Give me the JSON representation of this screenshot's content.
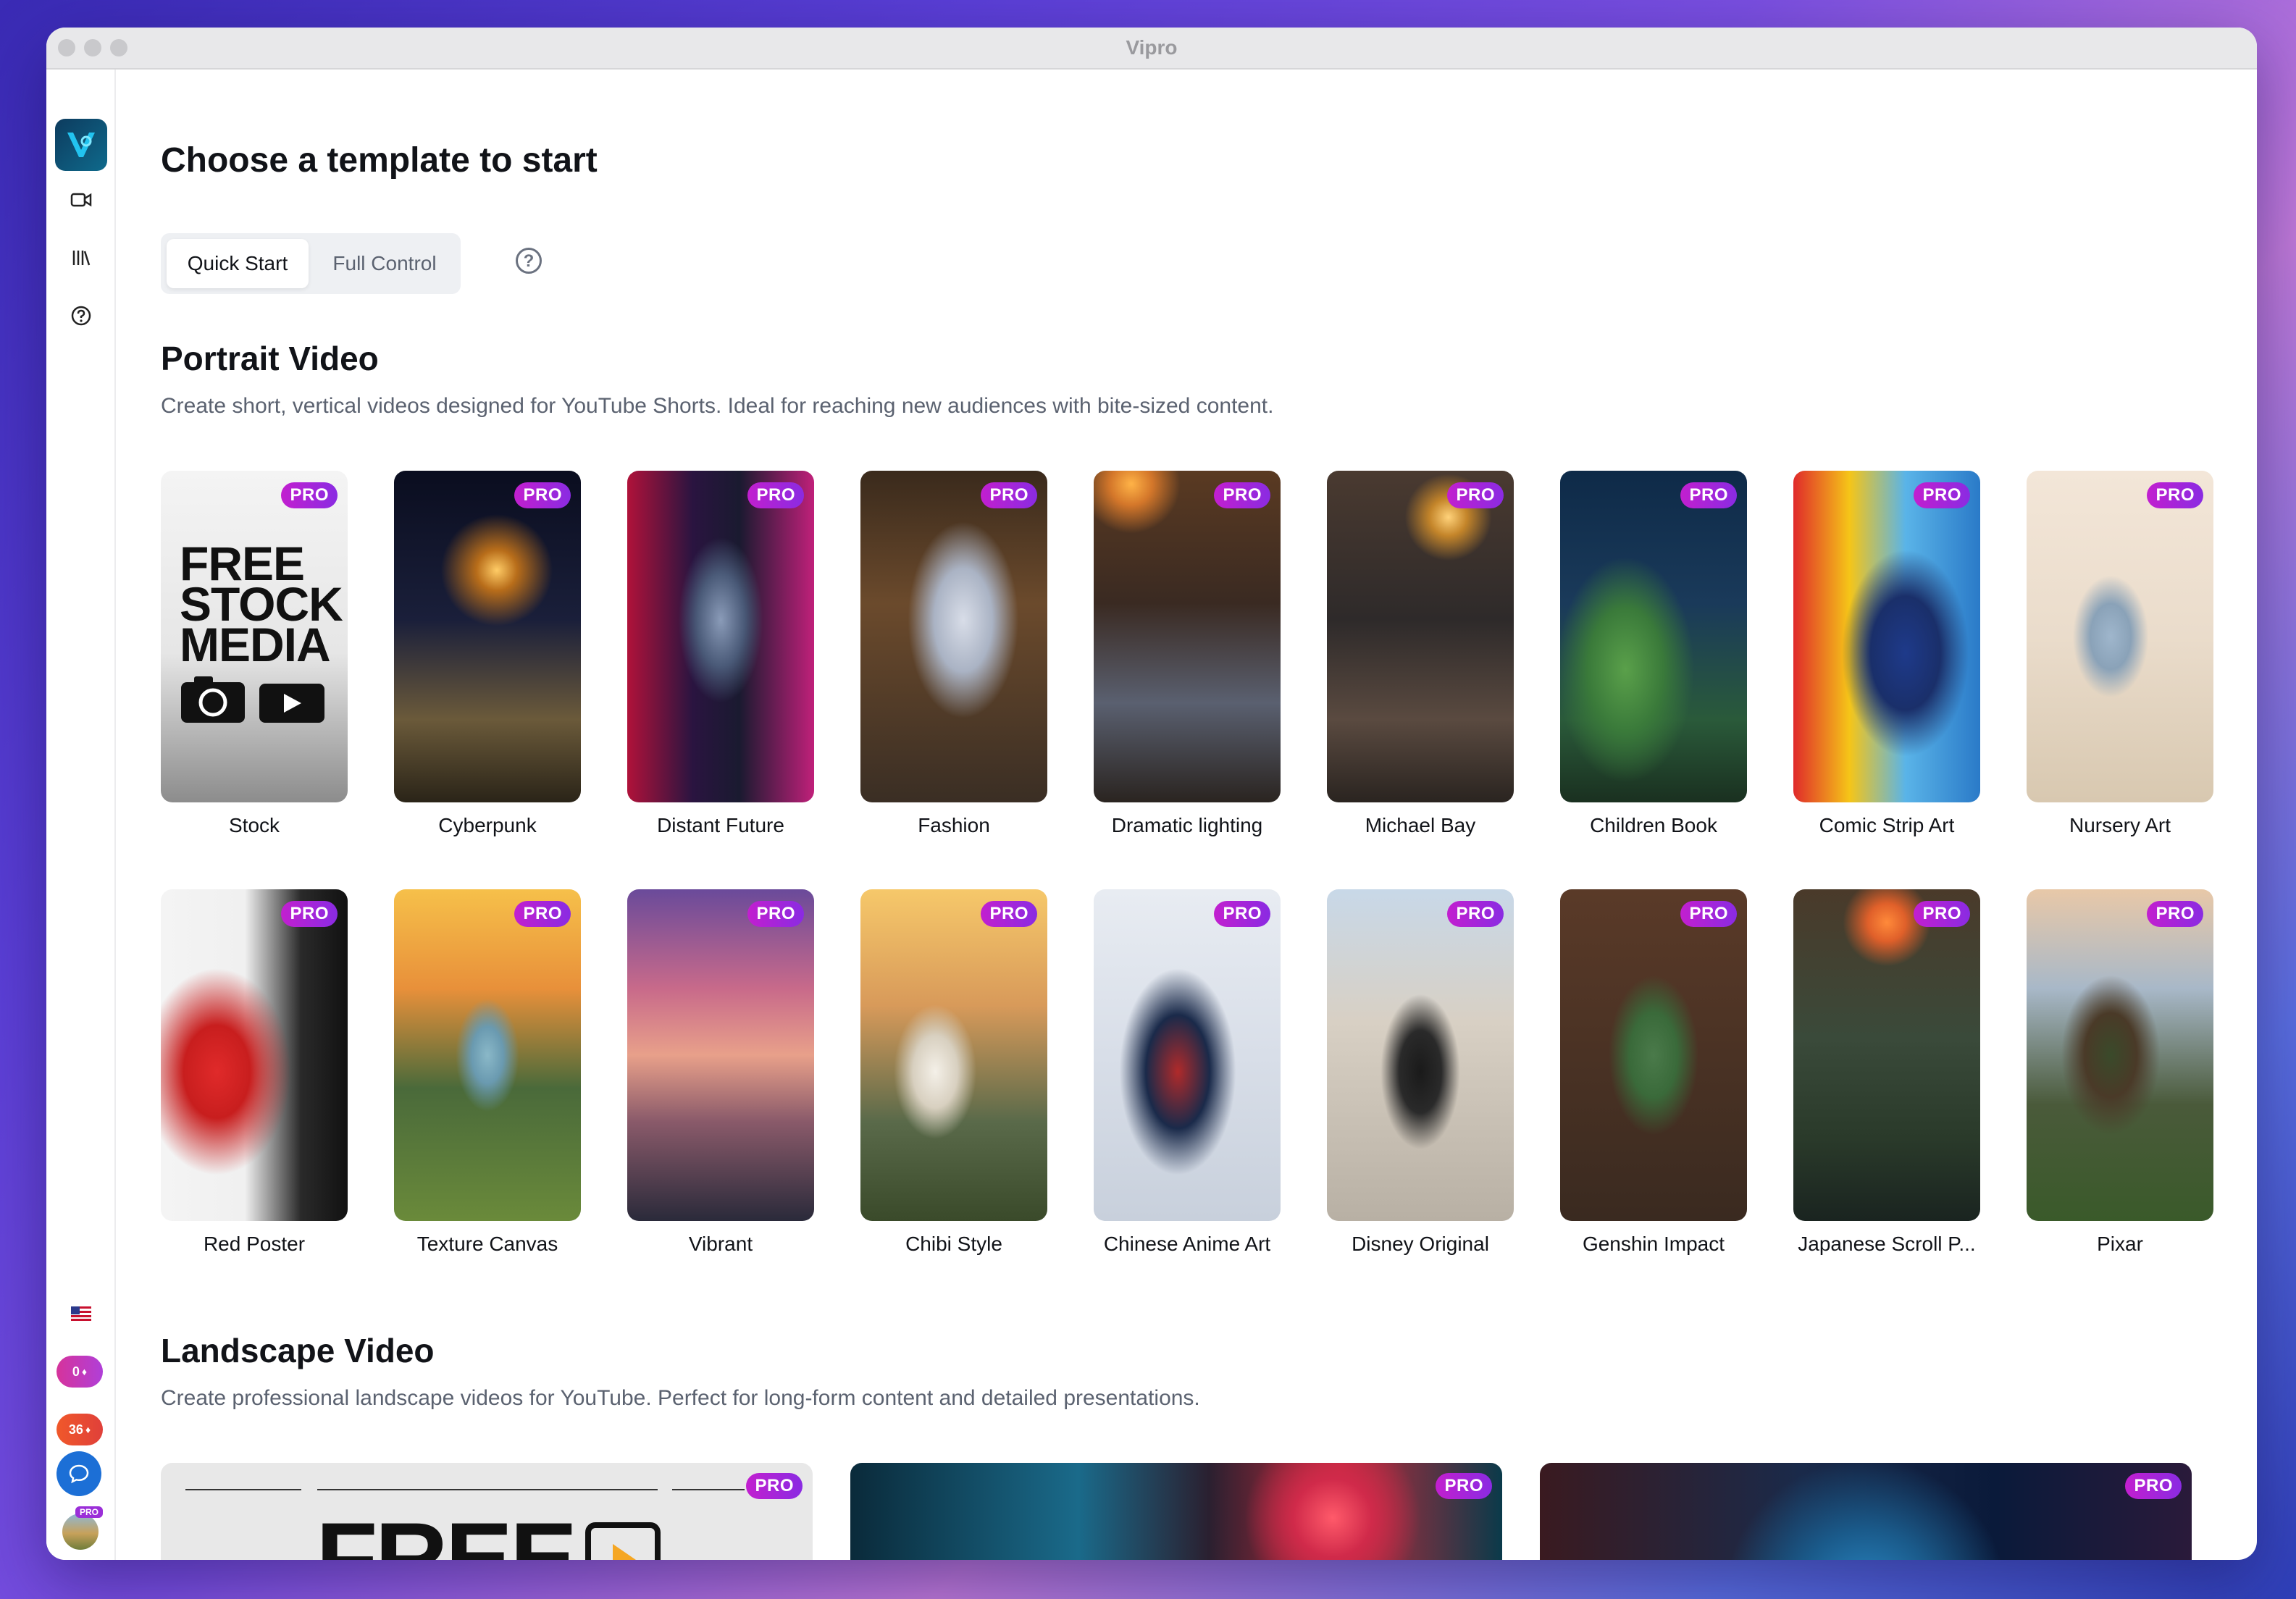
{
  "window": {
    "title": "Vipro"
  },
  "page": {
    "title": "Choose a template to start",
    "modes": [
      "Quick Start",
      "Full Control"
    ],
    "help_glyph": "?"
  },
  "sidebar": {
    "icons": [
      "video-camera-icon",
      "library-icon",
      "help-circle-icon"
    ],
    "credit_a": "0",
    "credit_b": "36"
  },
  "badge": "PRO",
  "portrait": {
    "title": "Portrait Video",
    "description": "Create short, vertical videos designed for YouTube Shorts. Ideal for reaching new audiences with bite-sized content.",
    "stock_text": "FREE STOCK MEDIA",
    "templates": [
      "Stock",
      "Cyberpunk",
      "Distant Future",
      "Fashion",
      "Dramatic lighting",
      "Michael Bay",
      "Children Book",
      "Comic Strip Art",
      "Nursery Art",
      "Red Poster",
      "Texture Canvas",
      "Vibrant",
      "Chibi Style",
      "Chinese Anime Art",
      "Disney Original",
      "Genshin Impact",
      "Japanese Scroll P...",
      "Pixar"
    ]
  },
  "landscape": {
    "title": "Landscape Video",
    "description": "Create professional landscape videos for YouTube. Perfect for long-form content and detailed presentations.",
    "stock_text": "FREE"
  },
  "colors": {
    "accent": "#1c6fd6",
    "pro_badge": "#b024d6",
    "text_primary": "#111318",
    "text_secondary": "#5b6270"
  }
}
